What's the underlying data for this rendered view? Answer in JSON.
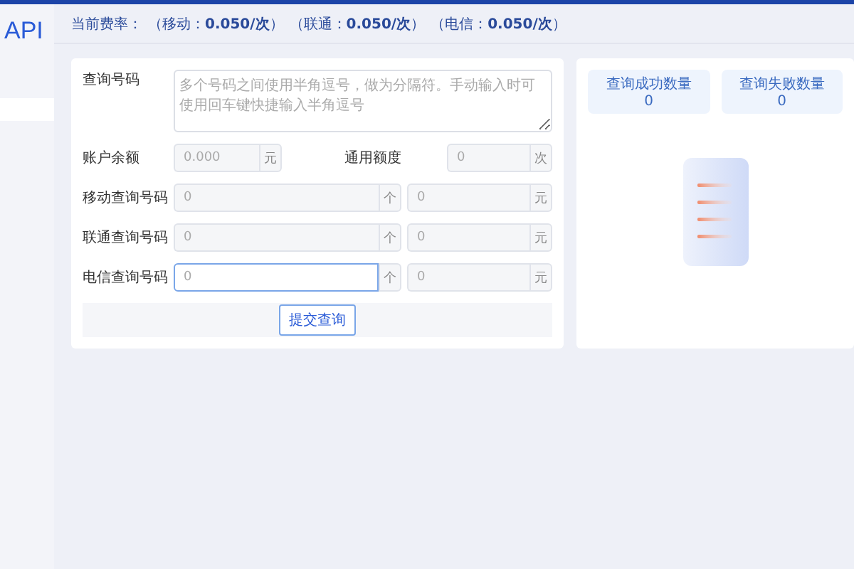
{
  "logo": {
    "text": "API"
  },
  "header": {
    "label": "当前费率：",
    "rates": [
      "（移动：**0.050/次**）",
      "（联通：**0.050/次**）",
      "（电信：**0.050/次**）"
    ]
  },
  "form": {
    "query_numbers": {
      "label": "查询号码",
      "placeholder": "多个号码之间使用半角逗号，做为分隔符。手动输入时可使用回车键快捷输入半角逗号"
    },
    "balance": {
      "label": "账户余额",
      "placeholder": "0.000",
      "unit": "元"
    },
    "quota": {
      "label": "通用额度",
      "placeholder": "0",
      "unit": "次"
    },
    "carriers": [
      {
        "label": "移动查询号码",
        "count": {
          "placeholder": "0",
          "unit": "个",
          "focused": false
        },
        "cost": {
          "placeholder": "0",
          "unit": "元"
        }
      },
      {
        "label": "联通查询号码",
        "count": {
          "placeholder": "0",
          "unit": "个",
          "focused": false
        },
        "cost": {
          "placeholder": "0",
          "unit": "元"
        }
      },
      {
        "label": "电信查询号码",
        "count": {
          "placeholder": "0",
          "unit": "个",
          "focused": true
        },
        "cost": {
          "placeholder": "0",
          "unit": "元"
        }
      }
    ],
    "submit": "提交查询"
  },
  "stats": [
    {
      "label": "查询成功数量",
      "value": "0"
    },
    {
      "label": "查询失败数量",
      "value": "0"
    }
  ]
}
